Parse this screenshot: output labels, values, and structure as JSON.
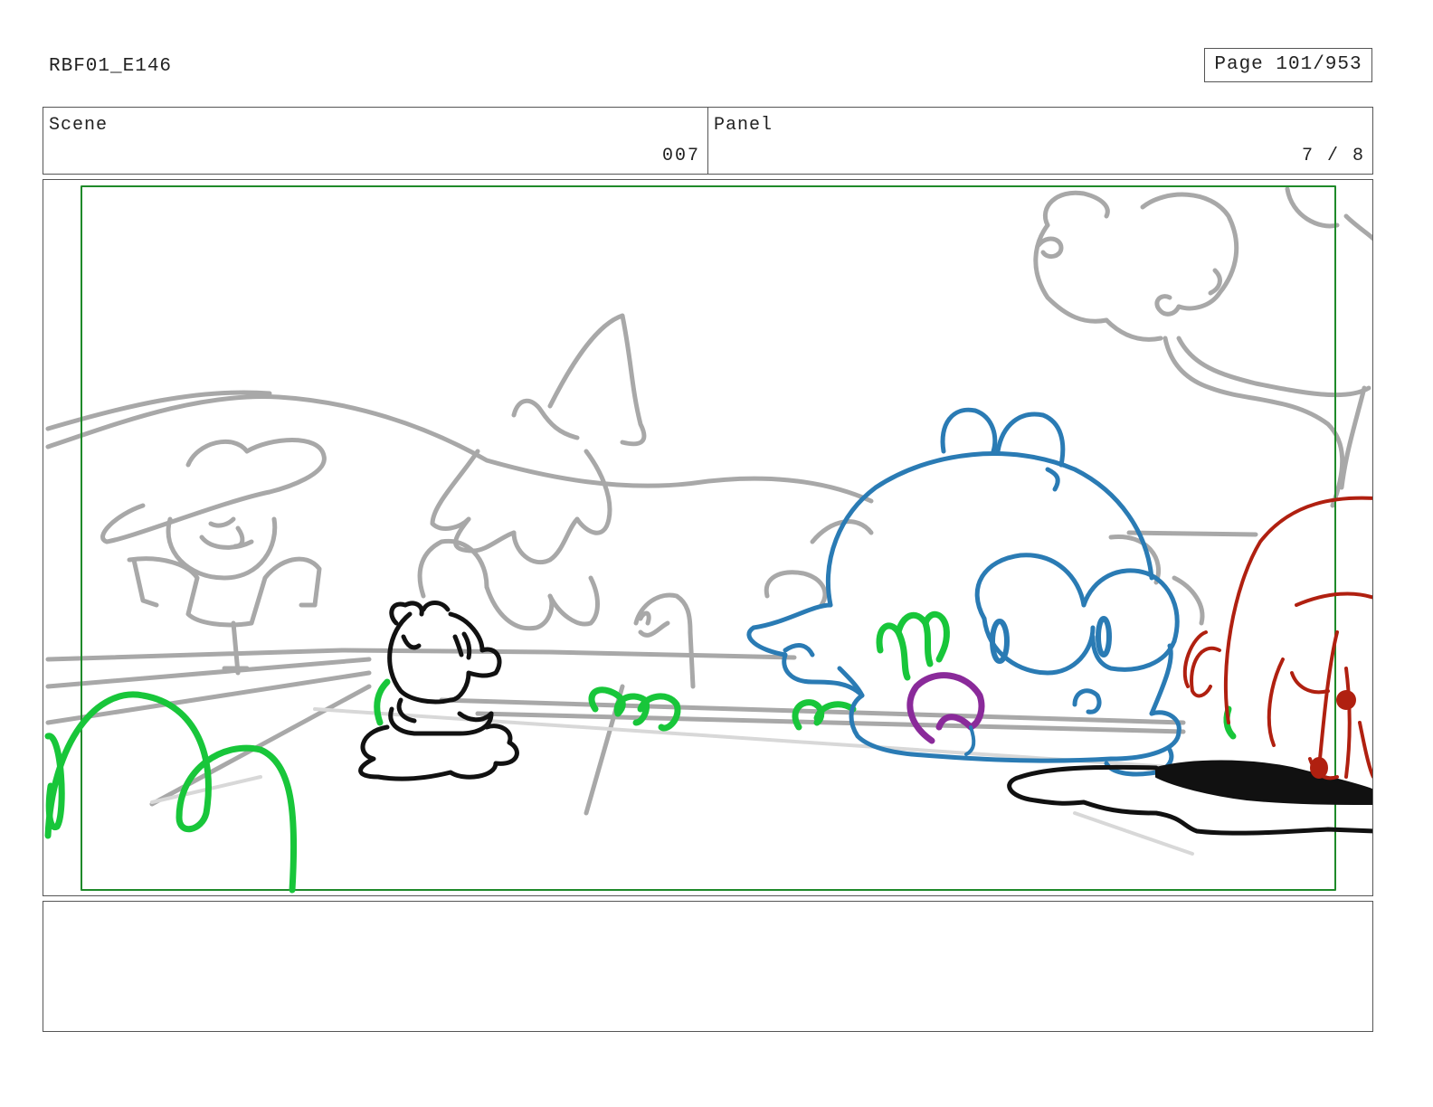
{
  "header": {
    "doc_id": "RBF01_E146",
    "page_label": "Page 101/953"
  },
  "info": {
    "scene_label": "Scene",
    "scene_value": "007",
    "panel_label": "Panel",
    "panel_value": "7 / 8"
  },
  "notes": {
    "text": ""
  },
  "colors": {
    "safe_frame": "#1f8a2a",
    "background_sketch": "#a8a8a8",
    "character_blue": "#2a7bb4",
    "character_red": "#b02010",
    "grass_green": "#18c63a",
    "mouth_purple": "#8a2a9a",
    "ink_black": "#111111"
  }
}
